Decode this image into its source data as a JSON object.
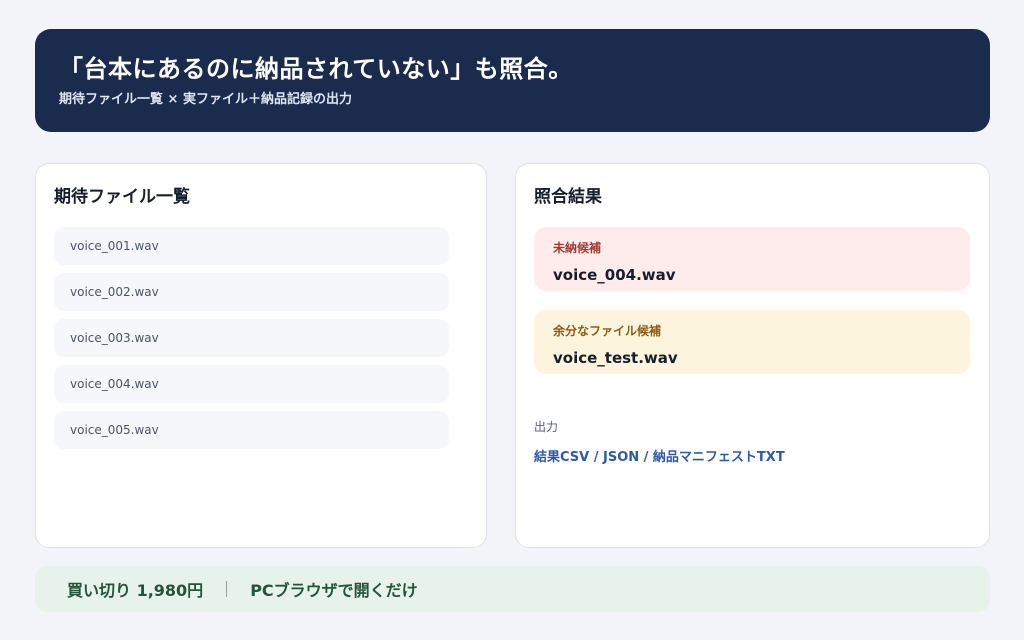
{
  "header": {
    "title": "「台本にあるのに納品されていない」も照合。",
    "subtitle": "期待ファイル一覧 × 実ファイル＋納品記録の出力"
  },
  "expected": {
    "title": "期待ファイル一覧",
    "files": [
      "voice_001.wav",
      "voice_002.wav",
      "voice_003.wav",
      "voice_004.wav",
      "voice_005.wav"
    ]
  },
  "results": {
    "title": "照合結果",
    "missing": {
      "label": "未納候補",
      "value": "voice_004.wav"
    },
    "extra": {
      "label": "余分なファイル候補",
      "value": "voice_test.wav"
    },
    "output": {
      "label": "出力",
      "formats": "結果CSV / JSON / 納品マニフェストTXT"
    }
  },
  "footer": {
    "price": "買い切り 1,980円",
    "note": "PCブラウザで開くだけ"
  },
  "colors": {
    "header_bg": "#1b2b4d",
    "missing_bg": "#fdeceb",
    "extra_bg": "#fdf4de",
    "link": "#2d5aa8",
    "footer_bg": "#e7f3ea"
  }
}
